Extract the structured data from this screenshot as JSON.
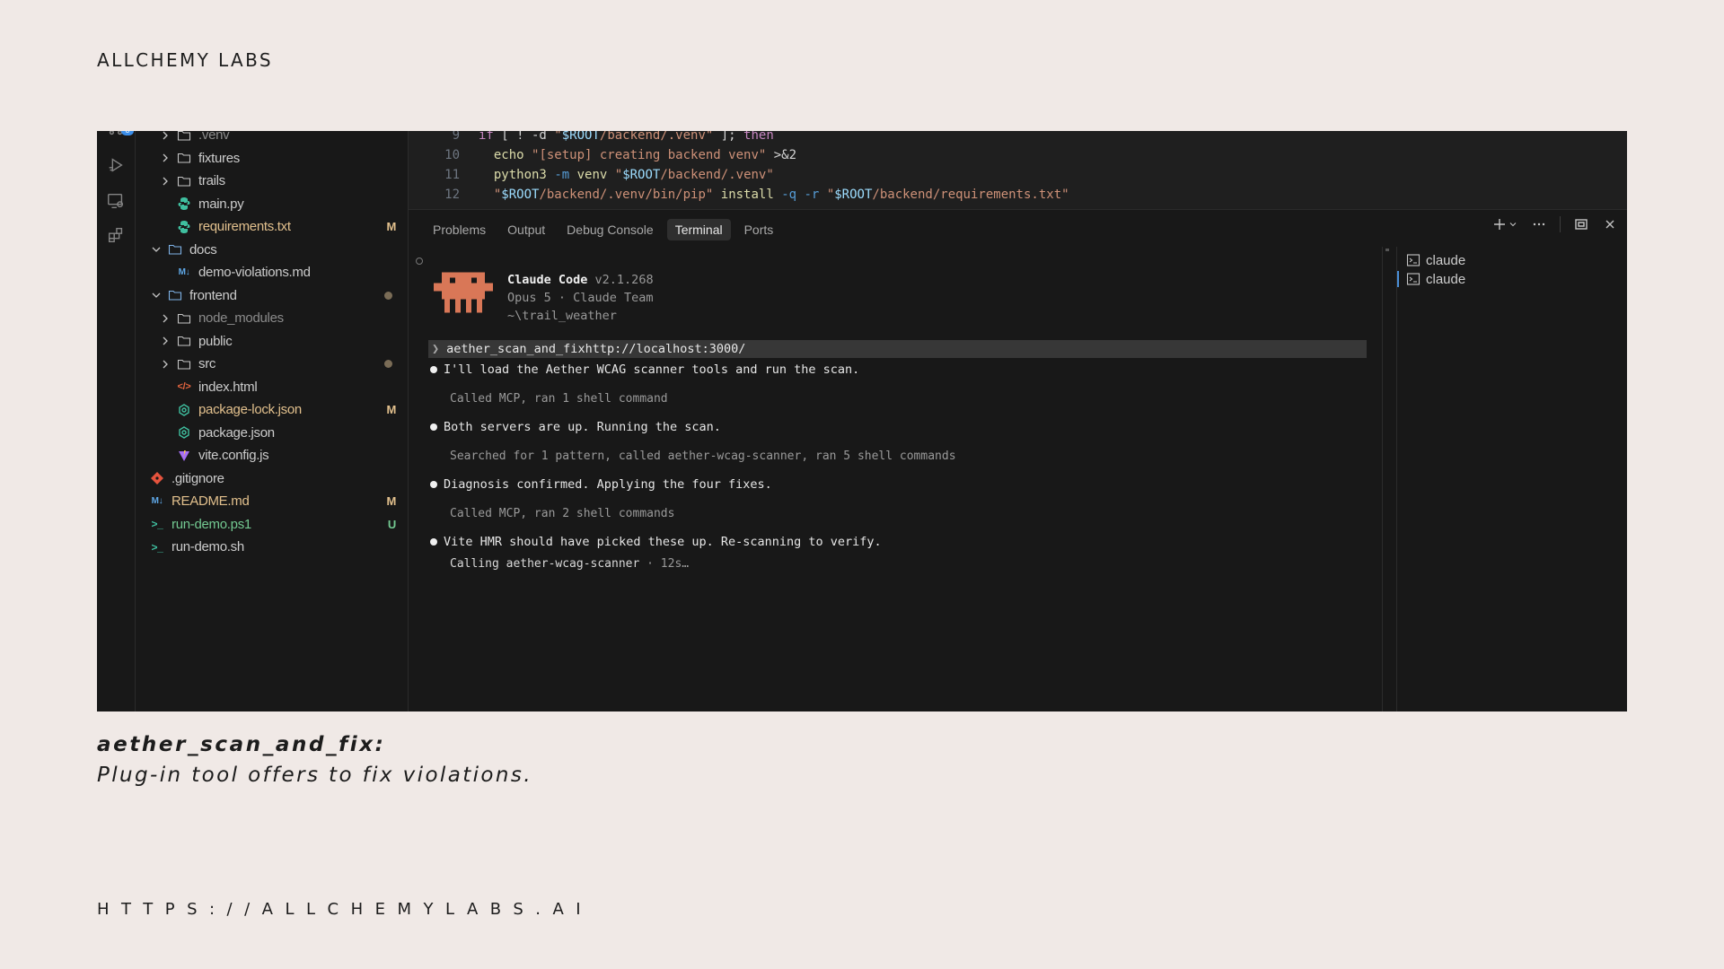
{
  "brand": "ALLCHEMY LABS",
  "explorer": {
    "rows": [
      {
        "label": ".venv",
        "kind": "folder",
        "depth": 1
      },
      {
        "label": "fixtures",
        "kind": "folder",
        "depth": 1
      },
      {
        "label": "trails",
        "kind": "folder",
        "depth": 1
      },
      {
        "label": "main.py",
        "kind": "python",
        "depth": 1
      },
      {
        "label": "requirements.txt",
        "kind": "python",
        "depth": 1,
        "status": "M"
      },
      {
        "label": "docs",
        "kind": "folder-open",
        "depth": 0
      },
      {
        "label": "demo-violations.md",
        "kind": "markdown",
        "depth": 1
      },
      {
        "label": "frontend",
        "kind": "folder-open",
        "depth": 0,
        "dot": true
      },
      {
        "label": "node_modules",
        "kind": "folder",
        "depth": 1
      },
      {
        "label": "public",
        "kind": "folder",
        "depth": 1
      },
      {
        "label": "src",
        "kind": "folder",
        "depth": 1,
        "dot": true
      },
      {
        "label": "index.html",
        "kind": "html",
        "depth": 1
      },
      {
        "label": "package-lock.json",
        "kind": "json",
        "depth": 1,
        "status": "M"
      },
      {
        "label": "package.json",
        "kind": "json",
        "depth": 1
      },
      {
        "label": "vite.config.js",
        "kind": "vite",
        "depth": 1
      },
      {
        "label": ".gitignore",
        "kind": "git",
        "depth": 0
      },
      {
        "label": "README.md",
        "kind": "markdown",
        "depth": 0,
        "status": "M"
      },
      {
        "label": "run-demo.ps1",
        "kind": "shell",
        "depth": 0,
        "status": "U"
      },
      {
        "label": "run-demo.sh",
        "kind": "shell",
        "depth": 0
      }
    ]
  },
  "editor": {
    "lines": [
      {
        "num": "9",
        "tokens": [
          [
            "kw",
            "if"
          ],
          [
            "plain",
            " [ ! -d "
          ],
          [
            "str",
            "\""
          ],
          [
            "var",
            "$ROOT"
          ],
          [
            "str",
            "/backend/.venv\""
          ],
          [
            "plain",
            " ]; "
          ],
          [
            "kw",
            "then"
          ]
        ]
      },
      {
        "num": "10",
        "tokens": [
          [
            "plain",
            "  "
          ],
          [
            "fn",
            "echo"
          ],
          [
            "plain",
            " "
          ],
          [
            "str",
            "\"[setup] creating backend venv\""
          ],
          [
            "plain",
            " >&2"
          ]
        ]
      },
      {
        "num": "11",
        "tokens": [
          [
            "plain",
            "  "
          ],
          [
            "fn",
            "python3"
          ],
          [
            "plain",
            " "
          ],
          [
            "flag",
            "-m"
          ],
          [
            "plain",
            " "
          ],
          [
            "fn",
            "venv"
          ],
          [
            "plain",
            " "
          ],
          [
            "str",
            "\""
          ],
          [
            "var",
            "$ROOT"
          ],
          [
            "str",
            "/backend/.venv\""
          ]
        ]
      },
      {
        "num": "12",
        "tokens": [
          [
            "plain",
            "  "
          ],
          [
            "str",
            "\""
          ],
          [
            "var",
            "$ROOT"
          ],
          [
            "str",
            "/backend/.venv/bin/pip\""
          ],
          [
            "plain",
            " "
          ],
          [
            "fn",
            "install"
          ],
          [
            "plain",
            " "
          ],
          [
            "flag",
            "-q -r"
          ],
          [
            "plain",
            " "
          ],
          [
            "str",
            "\""
          ],
          [
            "var",
            "$ROOT"
          ],
          [
            "str",
            "/backend/requirements.txt\""
          ]
        ]
      }
    ]
  },
  "panel": {
    "tabs": [
      "Problems",
      "Output",
      "Debug Console",
      "Terminal",
      "Ports"
    ],
    "active_tab": "Terminal"
  },
  "terminal": {
    "app_name": "Claude Code",
    "version": "v2.1.268",
    "model_line": "Opus 5 · Claude Team",
    "cwd": "~\\trail_weather",
    "prompt": "aether_scan_and_fixhttp://localhost:3000/",
    "messages": [
      {
        "text": "I'll load the Aether WCAG scanner tools and run the scan.",
        "sub": "Called MCP, ran 1 shell command"
      },
      {
        "text": "Both servers are up. Running the scan.",
        "sub": "Searched for 1 pattern, called aether-wcag-scanner, ran 5 shell commands"
      },
      {
        "text": "Diagnosis confirmed. Applying the four fixes.",
        "sub": "Called MCP, ran 2 shell commands"
      },
      {
        "text": "Vite HMR should have picked these up. Re-scanning to verify."
      }
    ],
    "calling_label": "Calling aether-wcag-scanner",
    "calling_time": " · 12s…"
  },
  "terminal_list": [
    "claude",
    "claude"
  ],
  "caption": {
    "title": "aether_scan_and_fix:",
    "subtitle": "Plug-in tool offers to fix violations."
  },
  "footer_url": "HTTPS://ALLCHEMYLABS.AI",
  "colors": {
    "accent": "#d97757",
    "modified": "#e2c08d",
    "untracked": "#73c991",
    "background": "#f0e9e6"
  }
}
